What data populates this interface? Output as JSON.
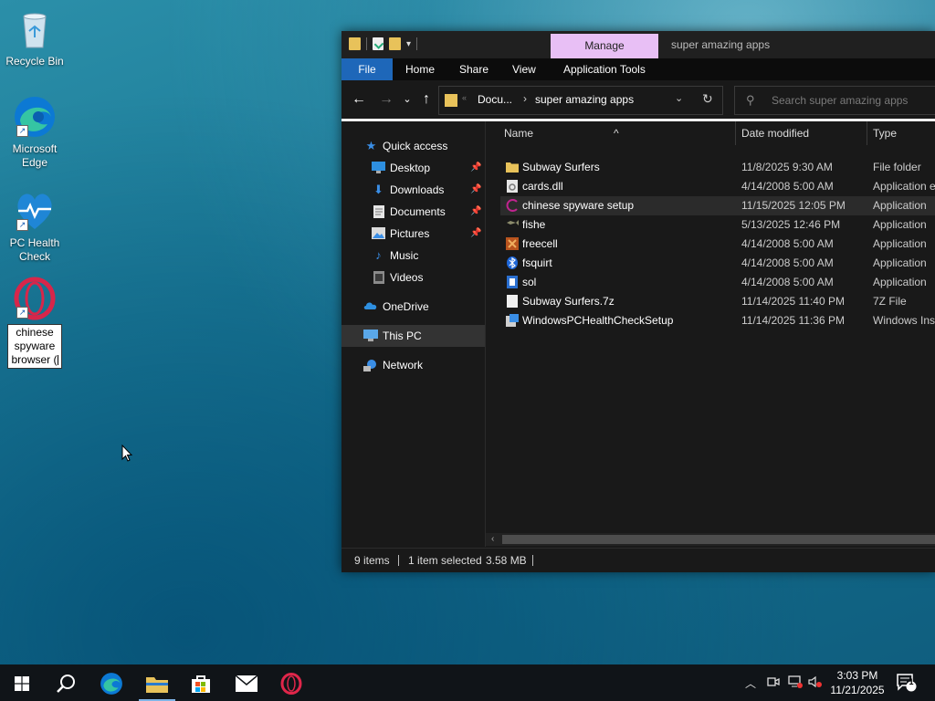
{
  "desktop": {
    "icons": [
      {
        "label": "Recycle Bin"
      },
      {
        "label": "Microsoft Edge"
      },
      {
        "label": "PC Health Check"
      },
      {
        "label": "chinese spyware browser ("
      }
    ]
  },
  "explorer": {
    "contextual_tab": "Manage",
    "title": "super amazing apps",
    "ribbon_tabs": [
      "File",
      "Home",
      "Share",
      "View",
      "Application Tools"
    ],
    "address": {
      "crumb1": "Docu...",
      "crumb2": "super amazing apps"
    },
    "search_placeholder": "Search super amazing apps",
    "nav": {
      "quick_access": "Quick access",
      "items": [
        "Desktop",
        "Downloads",
        "Documents",
        "Pictures",
        "Music",
        "Videos"
      ],
      "onedrive": "OneDrive",
      "this_pc": "This PC",
      "network": "Network"
    },
    "columns": {
      "name": "Name",
      "date": "Date modified",
      "type": "Type"
    },
    "files": [
      {
        "name": "Subway Surfers",
        "date": "11/8/2025 9:30 AM",
        "type": "File folder",
        "icon": "folder-icon"
      },
      {
        "name": "cards.dll",
        "date": "4/14/2008 5:00 AM",
        "type": "Application e",
        "icon": "dll-file-icon"
      },
      {
        "name": "chinese spyware setup",
        "date": "11/15/2025 12:05 PM",
        "type": "Application",
        "icon": "opera-setup-icon"
      },
      {
        "name": "fishe",
        "date": "5/13/2025 12:46 PM",
        "type": "Application",
        "icon": "fish-app-icon"
      },
      {
        "name": "freecell",
        "date": "4/14/2008 5:00 AM",
        "type": "Application",
        "icon": "freecell-icon"
      },
      {
        "name": "fsquirt",
        "date": "4/14/2008 5:00 AM",
        "type": "Application",
        "icon": "bluetooth-icon"
      },
      {
        "name": "sol",
        "date": "4/14/2008 5:00 AM",
        "type": "Application",
        "icon": "solitaire-icon"
      },
      {
        "name": "Subway Surfers.7z",
        "date": "11/14/2025 11:40 PM",
        "type": "7Z File",
        "icon": "archive-file-icon"
      },
      {
        "name": "WindowsPCHealthCheckSetup",
        "date": "11/14/2025 11:36 PM",
        "type": "Windows Inst",
        "icon": "installer-icon"
      }
    ],
    "status": {
      "count": "9 items",
      "selected": "1 item selected",
      "size": "3.58 MB"
    }
  },
  "taskbar": {
    "time": "3:03 PM",
    "date": "11/21/2025",
    "notification_count": "1"
  },
  "colors": {
    "accent": "#1e67b9",
    "manage_tab": "#e8bff5",
    "folder": "#e8c25a"
  }
}
